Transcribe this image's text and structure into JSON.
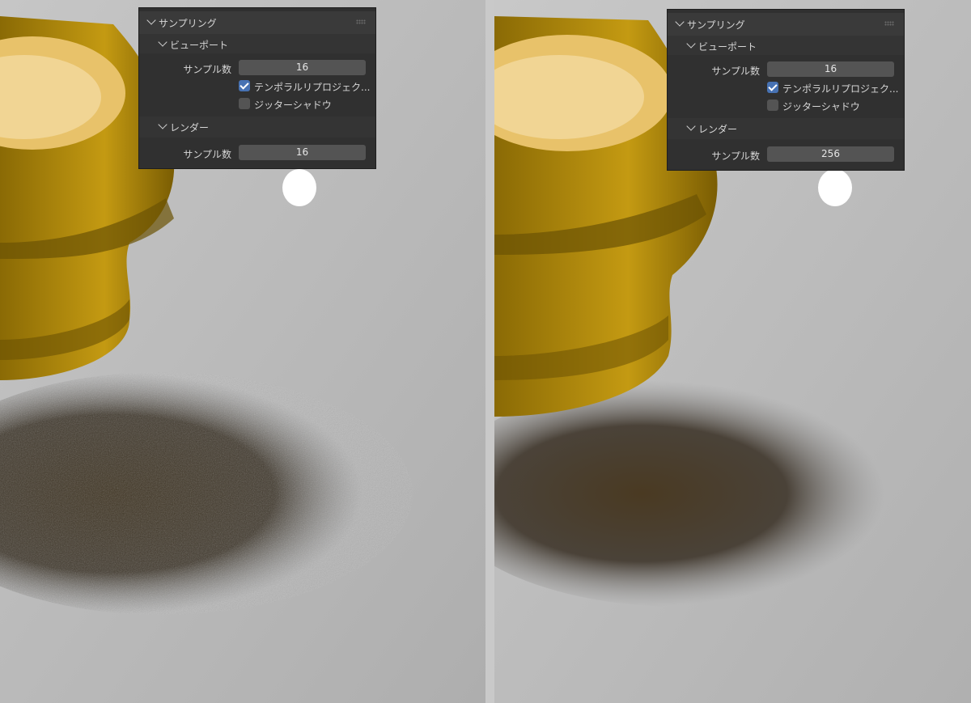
{
  "panels": {
    "left": {
      "title": "サンプリング",
      "viewport": {
        "title": "ビューポート",
        "samples_label": "サンプル数",
        "samples_value": "16",
        "temporal_label": "テンポラルリプロジェク...",
        "temporal_checked": true,
        "jitter_label": "ジッターシャドウ",
        "jitter_checked": false
      },
      "render": {
        "title": "レンダー",
        "samples_label": "サンプル数",
        "samples_value": "16"
      }
    },
    "right": {
      "title": "サンプリング",
      "viewport": {
        "title": "ビューポート",
        "samples_label": "サンプル数",
        "samples_value": "16",
        "temporal_label": "テンポラルリプロジェク...",
        "temporal_checked": true,
        "jitter_label": "ジッターシャドウ",
        "jitter_checked": false
      },
      "render": {
        "title": "レンダー",
        "samples_label": "サンプル数",
        "samples_value": "256"
      }
    }
  },
  "colors": {
    "panel_bg": "#303030",
    "field_bg": "#545454",
    "checkbox_on": "#4772b3",
    "pot_gold": "#b8860b",
    "floor": "#bdbdbd"
  },
  "icons": [
    "chevron-down-icon",
    "drag-grip-icon",
    "checkmark-icon"
  ]
}
